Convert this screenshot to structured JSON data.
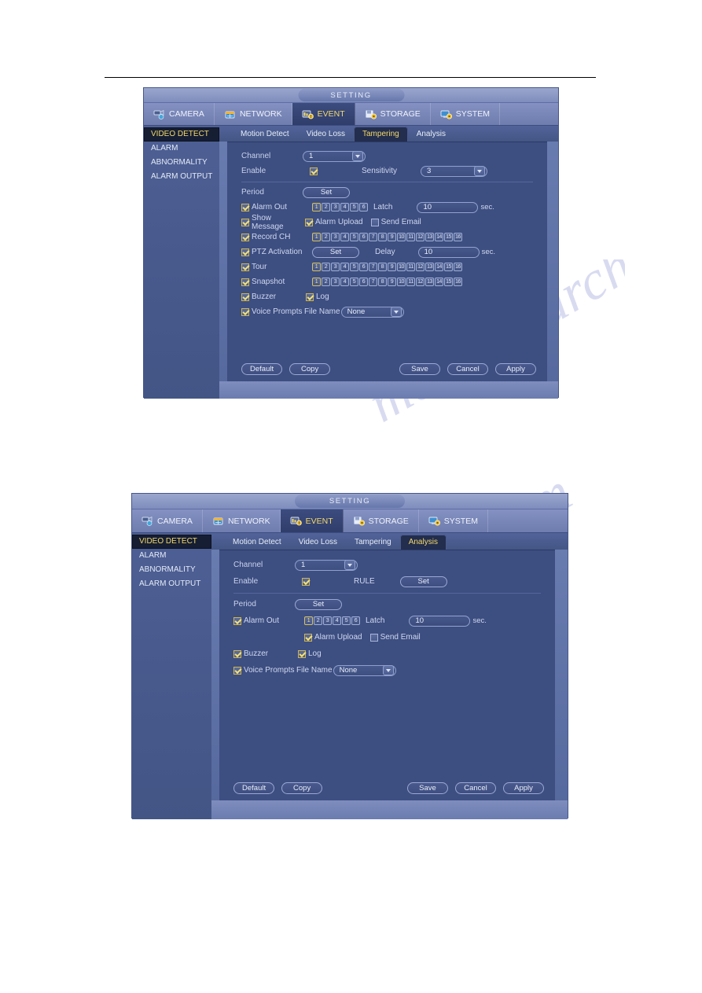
{
  "panels": [
    {
      "title": "SETTING",
      "nav": [
        {
          "label": "CAMERA",
          "icon": "camera-icon",
          "active": false
        },
        {
          "label": "NETWORK",
          "icon": "network-icon",
          "active": false
        },
        {
          "label": "EVENT",
          "icon": "event-icon",
          "active": true
        },
        {
          "label": "STORAGE",
          "icon": "storage-icon",
          "active": false
        },
        {
          "label": "SYSTEM",
          "icon": "system-icon",
          "active": false
        }
      ],
      "sidebar": [
        {
          "label": "VIDEO DETECT",
          "active": true
        },
        {
          "label": "ALARM",
          "active": false
        },
        {
          "label": "ABNORMALITY",
          "active": false
        },
        {
          "label": "ALARM OUTPUT",
          "active": false
        }
      ],
      "tabs": [
        {
          "label": "Motion Detect",
          "active": false
        },
        {
          "label": "Video Loss",
          "active": false
        },
        {
          "label": "Tampering",
          "active": true
        },
        {
          "label": "Analysis",
          "active": false
        }
      ],
      "form": {
        "channel_label": "Channel",
        "channel_value": "1",
        "enable_label": "Enable",
        "enable_checked": true,
        "sensitivity_label": "Sensitivity",
        "sensitivity_value": "3",
        "period_label": "Period",
        "period_button": "Set",
        "alarm_out_label": "Alarm Out",
        "alarm_out_checked": true,
        "alarm_out_chips": [
          "1",
          "2",
          "3",
          "4",
          "5",
          "6"
        ],
        "alarm_out_selected": "1",
        "latch_label": "Latch",
        "latch_value": "10",
        "latch_unit": "sec.",
        "show_message_label": "Show Message",
        "show_message_checked": true,
        "alarm_upload_label": "Alarm Upload",
        "alarm_upload_checked": true,
        "send_email_label": "Send Email",
        "send_email_checked": false,
        "record_ch_label": "Record CH",
        "record_ch_checked": true,
        "record_ch_chips": [
          "1",
          "2",
          "3",
          "4",
          "5",
          "6",
          "7",
          "8",
          "9",
          "10",
          "11",
          "12",
          "13",
          "14",
          "15",
          "16"
        ],
        "record_ch_selected": "1",
        "ptz_label": "PTZ Activation",
        "ptz_checked": true,
        "ptz_button": "Set",
        "delay_label": "Delay",
        "delay_value": "10",
        "delay_unit": "sec.",
        "tour_label": "Tour",
        "tour_checked": true,
        "tour_chips": [
          "1",
          "2",
          "3",
          "4",
          "5",
          "6",
          "7",
          "8",
          "9",
          "10",
          "11",
          "12",
          "13",
          "14",
          "15",
          "16"
        ],
        "tour_selected": "1",
        "snapshot_label": "Snapshot",
        "snapshot_checked": true,
        "snapshot_chips": [
          "1",
          "2",
          "3",
          "4",
          "5",
          "6",
          "7",
          "8",
          "9",
          "10",
          "11",
          "12",
          "13",
          "14",
          "15",
          "16"
        ],
        "snapshot_selected": "1",
        "buzzer_label": "Buzzer",
        "buzzer_checked": true,
        "log_label": "Log",
        "log_checked": true,
        "voice_label": "Voice Prompts",
        "voice_checked": true,
        "filename_label": "File Name",
        "filename_value": "None"
      },
      "buttons": {
        "default": "Default",
        "copy": "Copy",
        "save": "Save",
        "cancel": "Cancel",
        "apply": "Apply"
      }
    },
    {
      "title": "SETTING",
      "nav": [
        {
          "label": "CAMERA",
          "icon": "camera-icon",
          "active": false
        },
        {
          "label": "NETWORK",
          "icon": "network-icon",
          "active": false
        },
        {
          "label": "EVENT",
          "icon": "event-icon",
          "active": true
        },
        {
          "label": "STORAGE",
          "icon": "storage-icon",
          "active": false
        },
        {
          "label": "SYSTEM",
          "icon": "system-icon",
          "active": false
        }
      ],
      "sidebar": [
        {
          "label": "VIDEO DETECT",
          "active": true
        },
        {
          "label": "ALARM",
          "active": false
        },
        {
          "label": "ABNORMALITY",
          "active": false
        },
        {
          "label": "ALARM OUTPUT",
          "active": false
        }
      ],
      "tabs": [
        {
          "label": "Motion Detect",
          "active": false
        },
        {
          "label": "Video Loss",
          "active": false
        },
        {
          "label": "Tampering",
          "active": false
        },
        {
          "label": "Analysis",
          "active": true
        }
      ],
      "form": {
        "channel_label": "Channel",
        "channel_value": "1",
        "enable_label": "Enable",
        "enable_checked": true,
        "rule_label": "RULE",
        "rule_button": "Set",
        "period_label": "Period",
        "period_button": "Set",
        "alarm_out_label": "Alarm Out",
        "alarm_out_checked": true,
        "alarm_out_chips": [
          "1",
          "2",
          "3",
          "4",
          "5",
          "6"
        ],
        "alarm_out_selected": "1",
        "latch_label": "Latch",
        "latch_value": "10",
        "latch_unit": "sec.",
        "alarm_upload_label": "Alarm Upload",
        "alarm_upload_checked": true,
        "send_email_label": "Send Email",
        "send_email_checked": false,
        "buzzer_label": "Buzzer",
        "buzzer_checked": true,
        "log_label": "Log",
        "log_checked": true,
        "voice_label": "Voice Prompts",
        "voice_checked": true,
        "filename_label": "File Name",
        "filename_value": "None"
      },
      "buttons": {
        "default": "Default",
        "copy": "Copy",
        "save": "Save",
        "cancel": "Cancel",
        "apply": "Apply"
      }
    }
  ],
  "watermark": {
    "line1": "manualsarchive.com",
    "line2": "manualsarchive.com"
  },
  "colors": {
    "accent": "#f4d96b",
    "panel_bg": "#3d4e81",
    "nav_bg": "#7e8dbd",
    "active_tab_bg": "#232d4d"
  }
}
